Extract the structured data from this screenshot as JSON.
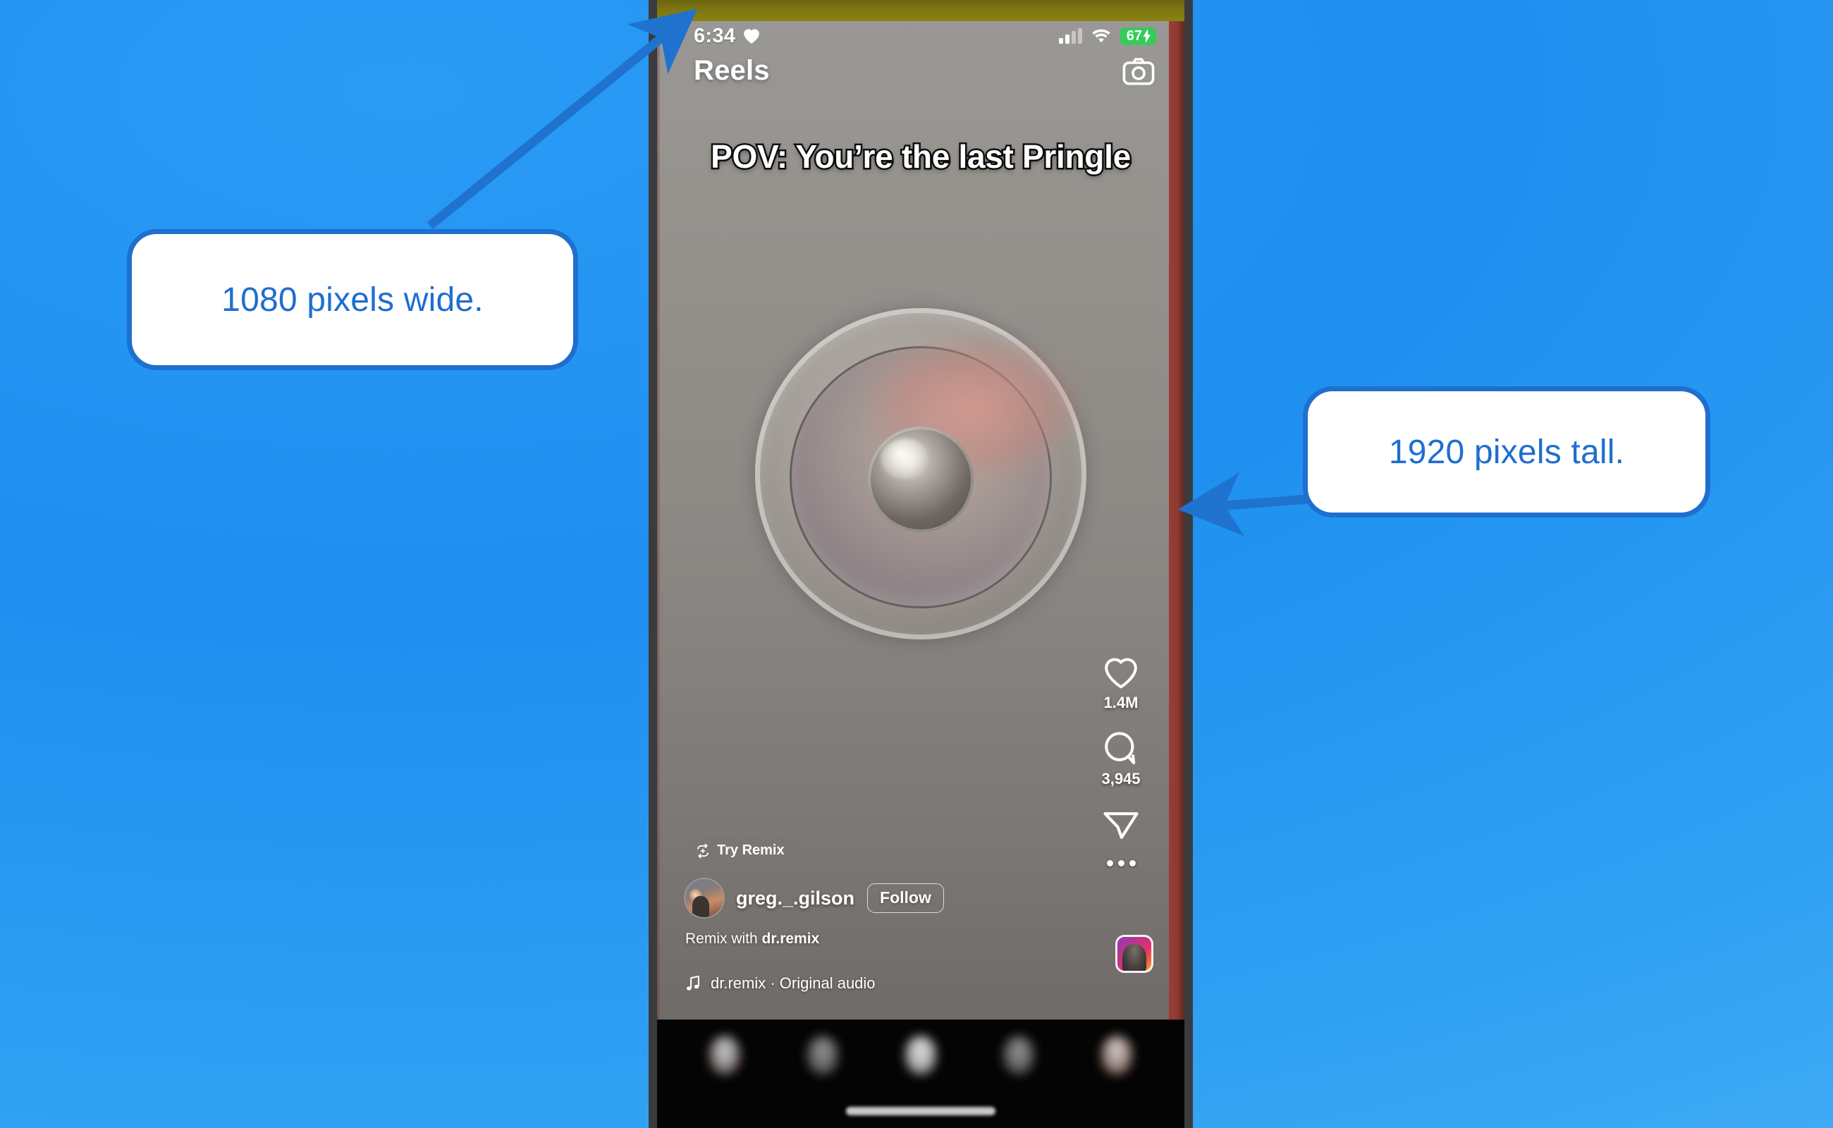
{
  "background": {
    "color_top_left": "#1E8FF0",
    "color_bottom_right": "#44AEF6"
  },
  "callouts": [
    {
      "id": "width",
      "text": "1080 pixels wide.",
      "border_color": "#1e6fce",
      "text_color": "#1f6ed0",
      "points_to": "status-bar-time"
    },
    {
      "id": "height",
      "text": "1920 pixels tall.",
      "border_color": "#1e6fce",
      "text_color": "#1f6ed0",
      "points_to": "phone-right-edge"
    }
  ],
  "phone": {
    "frame_color": "#3b3b3d",
    "status_bar": {
      "time": "6:34",
      "heart_icon": "heart-icon",
      "cellular_icon": "cellular-signal-icon",
      "wifi_icon": "wifi-icon",
      "battery_percent": "67",
      "battery_charging_icon": "lightning-bolt-icon",
      "battery_color": "#33cc58"
    },
    "header": {
      "title": "Reels",
      "camera_icon": "camera-icon"
    },
    "video": {
      "caption": "POV: You’re the last Pringle",
      "top_stripe_color": "#7e7610",
      "right_stripe_color": "#8d3a32"
    },
    "action_rail": {
      "like": {
        "icon": "heart-icon",
        "count": "1.4M"
      },
      "comment": {
        "icon": "comment-bubble-icon",
        "count": "3,945"
      },
      "share": {
        "icon": "paper-plane-icon"
      },
      "more": {
        "icon": "ellipsis-icon"
      }
    },
    "overlay": {
      "try_remix": {
        "icon": "remix-icon",
        "label": "Try Remix"
      },
      "username": "greg._.gilson",
      "follow_label": "Follow",
      "remix_with_prefix": "Remix with ",
      "remix_with_account": "dr.remix",
      "audio_icon": "music-note-icon",
      "audio_label": "dr.remix · Original audio",
      "audio_thumbnail": "audio-cover-thumbnail"
    },
    "bottom_nav": {
      "items": [
        {
          "icon": "home-icon"
        },
        {
          "icon": "search-icon"
        },
        {
          "icon": "create-icon"
        },
        {
          "icon": "activity-heart-icon"
        },
        {
          "icon": "profile-avatar-icon"
        }
      ],
      "home_indicator": "home-indicator"
    }
  }
}
